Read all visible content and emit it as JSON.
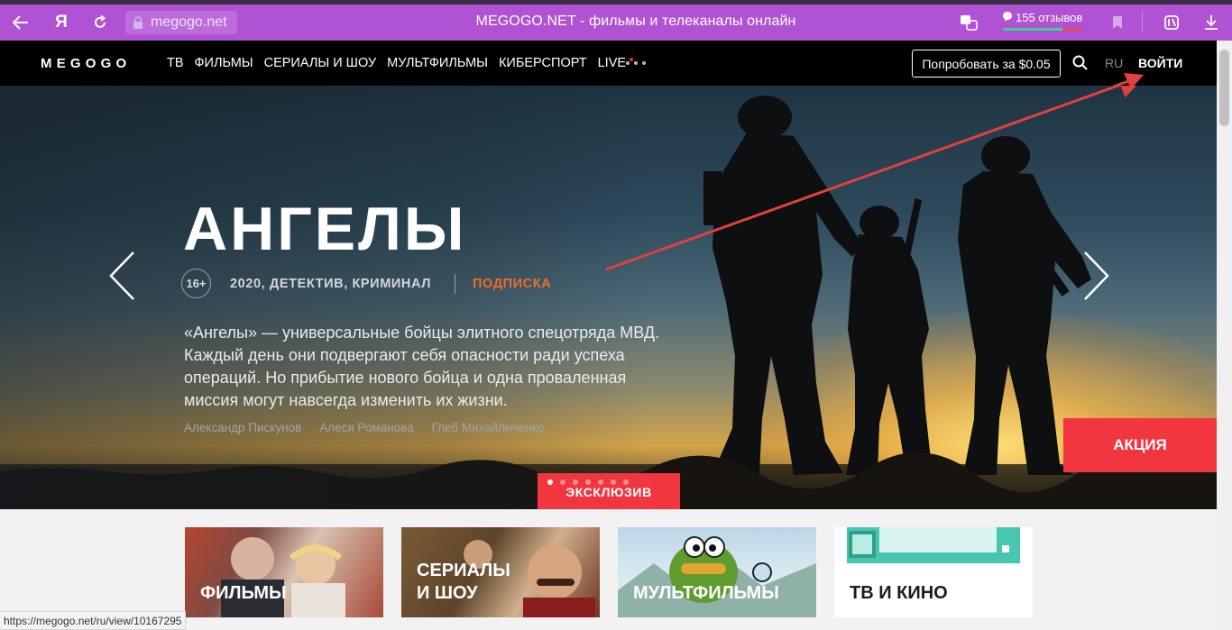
{
  "browser": {
    "url": "megogo.net",
    "page_title": "MEGOGO.NET - фильмы и телеканалы онлайн",
    "reviews_label": "155 отзывов",
    "accent_color": "#b052d4"
  },
  "header": {
    "logo": "MEGOGO",
    "nav": [
      "ТВ",
      "ФИЛЬМЫ",
      "СЕРИАЛЫ И ШОУ",
      "МУЛЬТФИЛЬМЫ",
      "КИБЕРСПОРТ",
      "LIVE"
    ],
    "try_button": "Попробовать за $0.05",
    "language": "RU",
    "login": "ВОЙТИ"
  },
  "hero": {
    "title": "АНГЕЛЫ",
    "age_rating": "16+",
    "meta": "2020, ДЕТЕКТИВ, КРИМИНАЛ",
    "access": "ПОДПИСКА",
    "description": "«Ангелы» — универсальные бойцы элитного спецотряда МВД. Каждый день они подвергают себя опасности ради успеха операций. Но прибытие нового бойца и одна проваленная миссия могут навсегда изменить их жизни.",
    "cast": [
      "Александр Пискунов",
      "Алеся Романова",
      "Глеб Михайличенко"
    ],
    "promo_button": "АКЦИЯ",
    "exclusive_label": "ЭКСКЛЮЗИВ",
    "slides": {
      "total": 7,
      "active": 1
    },
    "accent_red": "#f2363f",
    "accent_orange": "#ef6b2c"
  },
  "categories": [
    {
      "label": "ФИЛЬМЫ"
    },
    {
      "label_line1": "СЕРИАЛЫ",
      "label_line2": "И ШОУ"
    },
    {
      "label": "МУЛЬТФИЛЬМЫ"
    },
    {
      "label": "ТВ И КИНО"
    }
  ],
  "status_bar": {
    "url": "https://megogo.net/ru/view/10167295"
  }
}
